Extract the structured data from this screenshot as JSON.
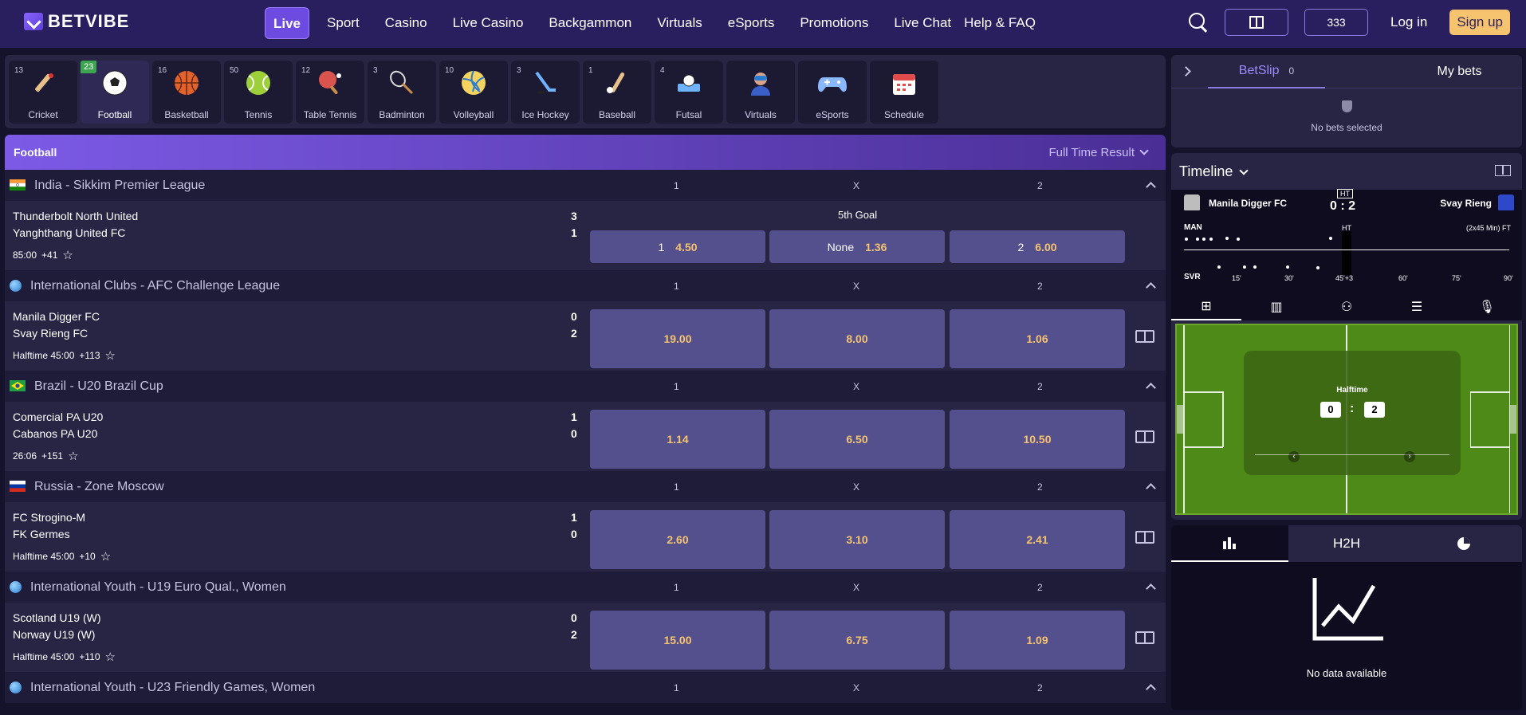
{
  "brand": {
    "name": "BETVIBE"
  },
  "nav": [
    "Live",
    "Sport",
    "Casino",
    "Live Casino",
    "Backgammon",
    "Virtuals",
    "eSports",
    "Promotions",
    "Live Chat",
    "Help & FAQ"
  ],
  "header": {
    "balance": "333",
    "login": "Log in",
    "signup": "Sign up"
  },
  "sports": [
    {
      "count": "13",
      "label": "Cricket"
    },
    {
      "count": "23",
      "label": "Football"
    },
    {
      "count": "16",
      "label": "Basketball"
    },
    {
      "count": "50",
      "label": "Tennis"
    },
    {
      "count": "12",
      "label": "Table Tennis"
    },
    {
      "count": "3",
      "label": "Badminton"
    },
    {
      "count": "10",
      "label": "Volleyball"
    },
    {
      "count": "3",
      "label": "Ice Hockey"
    },
    {
      "count": "1",
      "label": "Baseball"
    },
    {
      "count": "4",
      "label": "Futsal"
    },
    {
      "count": "",
      "label": "Virtuals"
    },
    {
      "count": "",
      "label": "eSports"
    },
    {
      "count": "",
      "label": "Schedule"
    }
  ],
  "events": {
    "title": "Football",
    "market": "Full Time Result",
    "col1": "1",
    "colx": "X",
    "col2": "2",
    "leagues": [
      {
        "name": "India - Sikkim Premier League",
        "home": "Thunderbolt North United",
        "away": "Yanghthang United FC",
        "hs": "3",
        "as": "1",
        "time": "85:00",
        "more": "+41",
        "market_label": "5th Goal",
        "o1_label": "1",
        "o1": "4.50",
        "ox_label": "None",
        "ox": "1.36",
        "o2_label": "2",
        "o2": "6.00"
      },
      {
        "name": "International Clubs - AFC Challenge League",
        "home": "Manila Digger FC",
        "away": "Svay Rieng FC",
        "hs": "0",
        "as": "2",
        "time": "Halftime 45:00",
        "more": "+113",
        "o1": "19.00",
        "ox": "8.00",
        "o2": "1.06"
      },
      {
        "name": "Brazil - U20 Brazil Cup",
        "home": "Comercial PA U20",
        "away": "Cabanos PA U20",
        "hs": "1",
        "as": "0",
        "time": "26:06",
        "more": "+151",
        "o1": "1.14",
        "ox": "6.50",
        "o2": "10.50"
      },
      {
        "name": "Russia - Zone Moscow",
        "home": "FC Strogino-M",
        "away": "FK Germes",
        "hs": "1",
        "as": "0",
        "time": "Halftime 45:00",
        "more": "+10",
        "o1": "2.60",
        "ox": "3.10",
        "o2": "2.41"
      },
      {
        "name": "International Youth - U19 Euro Qual., Women",
        "home": "Scotland U19 (W)",
        "away": "Norway U19 (W)",
        "hs": "0",
        "as": "2",
        "time": "Halftime 45:00",
        "more": "+110",
        "o1": "15.00",
        "ox": "6.75",
        "o2": "1.09"
      },
      {
        "name": "International Youth - U23 Friendly Games, Women"
      }
    ]
  },
  "betslip": {
    "tab1": "BetSlip",
    "count": "0",
    "tab2": "My bets",
    "empty": "No bets selected"
  },
  "timeline": {
    "title": "Timeline",
    "home": "Manila Digger FC",
    "away": "Svay Rieng",
    "ht_label": "HT",
    "score": "0 : 2",
    "home_abbr": "MAN",
    "away_abbr": "SVR",
    "duration": "(2x45 Min) FT",
    "ticks": [
      "15'",
      "30'",
      "45'+3",
      "60'",
      "75'",
      "90'"
    ],
    "field_status": "Halftime",
    "field_home": "0",
    "field_away": "2"
  },
  "stats": {
    "tab2": "H2H",
    "empty": "No data available"
  }
}
